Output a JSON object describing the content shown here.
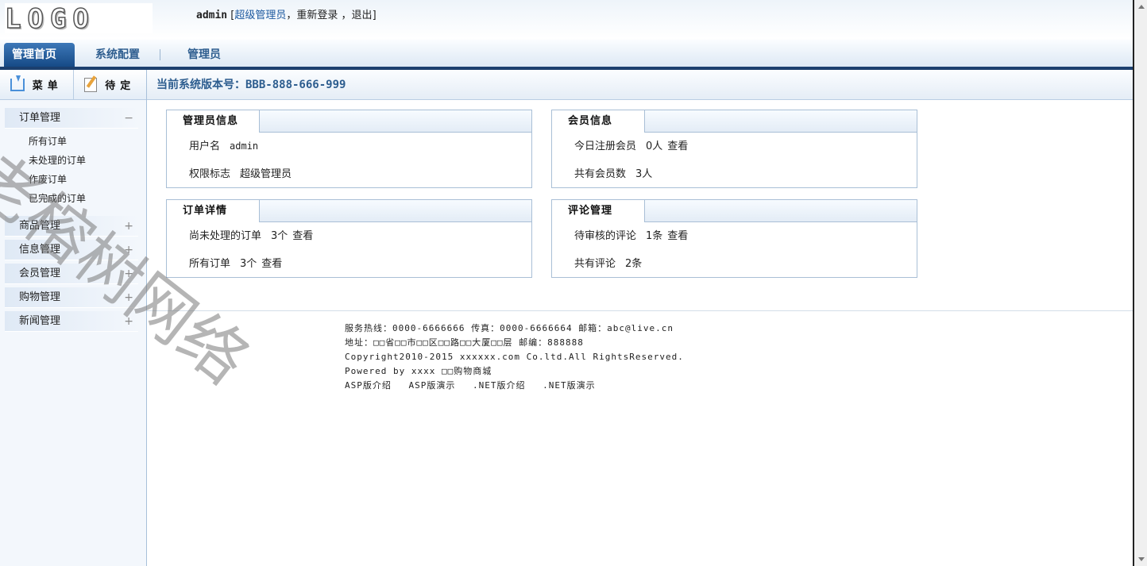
{
  "header": {
    "logo_text": "LOGO",
    "user": "admin",
    "open_bracket": "[",
    "role": "超级管理员",
    "sep1": "，",
    "relogin": "重新登录",
    "sep2": " ，",
    "logout": "退出",
    "close_bracket": "]"
  },
  "nav": {
    "tabs": [
      {
        "label": "管理首页"
      },
      {
        "label": "系统配置"
      },
      {
        "label": "管理员"
      }
    ]
  },
  "sidebar": {
    "tab_menu": "菜单",
    "tab_pending": "待定",
    "groups": [
      {
        "title": "订单管理",
        "sign": "−",
        "items": [
          "所有订单",
          "未处理的订单",
          "作废订单",
          "已完成的订单"
        ]
      },
      {
        "title": "商品管理",
        "sign": "+"
      },
      {
        "title": "信息管理",
        "sign": "+"
      },
      {
        "title": "会员管理",
        "sign": "+"
      },
      {
        "title": "购物管理",
        "sign": "+"
      },
      {
        "title": "新闻管理",
        "sign": "+"
      }
    ]
  },
  "main": {
    "version_label": "当前系统版本号：",
    "version_value": "BBB-888-666-999",
    "panels": {
      "admin": {
        "title": "管理员信息",
        "rows": [
          {
            "label": "用户名",
            "value": "admin"
          },
          {
            "label": "权限标志",
            "value": "超级管理员"
          }
        ]
      },
      "member": {
        "title": "会员信息",
        "rows": [
          {
            "label": "今日注册会员",
            "value": "0人",
            "link": "查看"
          },
          {
            "label": "共有会员数",
            "value": "3人"
          }
        ]
      },
      "order": {
        "title": "订单详情",
        "rows": [
          {
            "label": "尚未处理的订单",
            "value": "3个",
            "link": "查看"
          },
          {
            "label": "所有订单",
            "value": "3个",
            "link": "查看"
          }
        ]
      },
      "comment": {
        "title": "评论管理",
        "rows": [
          {
            "label": "待审核的评论",
            "value": "1条",
            "link": "查看"
          },
          {
            "label": "共有评论",
            "value": "2条"
          }
        ]
      }
    }
  },
  "footer": {
    "line1": "服务热线：0000-6666666  传真：0000-6666664  邮箱：abc@live.cn",
    "line2": "地址：□□省□□市□□区□□路□□大厦□□层     邮编：888888",
    "line3": "Copyright2010-2015 xxxxxx.com Co.ltd.All RightsReserved.",
    "line4": "Powered by xxxx □□购物商城",
    "links": [
      "ASP版介绍",
      "ASP版演示",
      ".NET版介绍",
      ".NET版演示"
    ]
  },
  "watermark": "老榕树网络"
}
